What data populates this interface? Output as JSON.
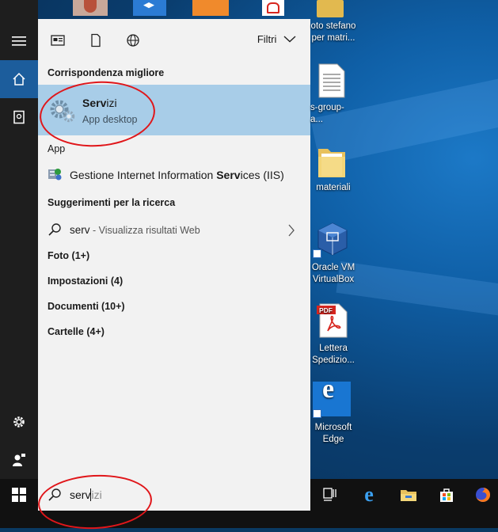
{
  "desktop_icons": [
    {
      "label": "oto stefano"
    },
    {
      "label": "per matri..."
    },
    {
      "label": "s-group-a..."
    },
    {
      "label": "materiali"
    },
    {
      "label": "Oracle VM"
    },
    {
      "label": "VirtualBox"
    },
    {
      "label": "Lettera"
    },
    {
      "label": "Spedizio..."
    },
    {
      "label": "Microsoft"
    },
    {
      "label": "Edge"
    }
  ],
  "search_panel": {
    "filter_label": "Filtri",
    "best_match_heading": "Corrispondenza migliore",
    "best_match": {
      "name_bold": "Serv",
      "name_rest": "izi",
      "subtitle": "App desktop"
    },
    "app_heading": "App",
    "app_item": {
      "pre": "Gestione Internet Information ",
      "bold": "Serv",
      "post": "ices (IIS)"
    },
    "suggestions_heading": "Suggerimenti per la ricerca",
    "suggestion": {
      "query": "serv",
      "hint": " - Visualizza risultati Web"
    },
    "categories": [
      "Foto (1+)",
      "Impostazioni (4)",
      "Documenti (10+)",
      "Cartelle (4+)"
    ]
  },
  "search_box": {
    "typed": "serv",
    "autocomplete": "izi"
  },
  "colors": {
    "accent": "#1c5d9c",
    "highlight": "#a8cde8",
    "annotation": "#e0161a"
  }
}
